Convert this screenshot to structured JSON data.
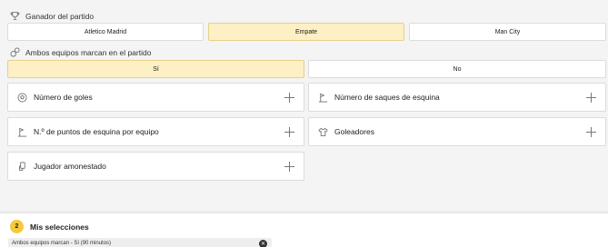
{
  "winner": {
    "title": "Ganador del partido",
    "icon": "trophy-icon",
    "options": [
      "Atletico Madrid",
      "Empate",
      "Man City"
    ],
    "selected": "Empate"
  },
  "btts": {
    "title": "Ambos equipos marcan en el partido",
    "icon": "balls-icon",
    "options": [
      "Sí",
      "No"
    ],
    "selected": "Sí"
  },
  "markets": [
    {
      "label": "Número de goles",
      "icon": "ball-icon"
    },
    {
      "label": "Número de saques de esquina",
      "icon": "corner-flag-icon"
    },
    {
      "label": "N.º de puntos de esquina por equipo",
      "icon": "corner-flag-icon"
    },
    {
      "label": "Goleadores",
      "icon": "shirt-icon"
    },
    {
      "label": "Jugador amonestado",
      "icon": "card-icon"
    }
  ],
  "betslip": {
    "count": "2",
    "title": "Mis selecciones",
    "selection": "Ambos equipos marcan - Sí (90 minutos)"
  },
  "colors": {
    "selected_bg": "#fcf0c4",
    "badge": "#f5c93e"
  }
}
